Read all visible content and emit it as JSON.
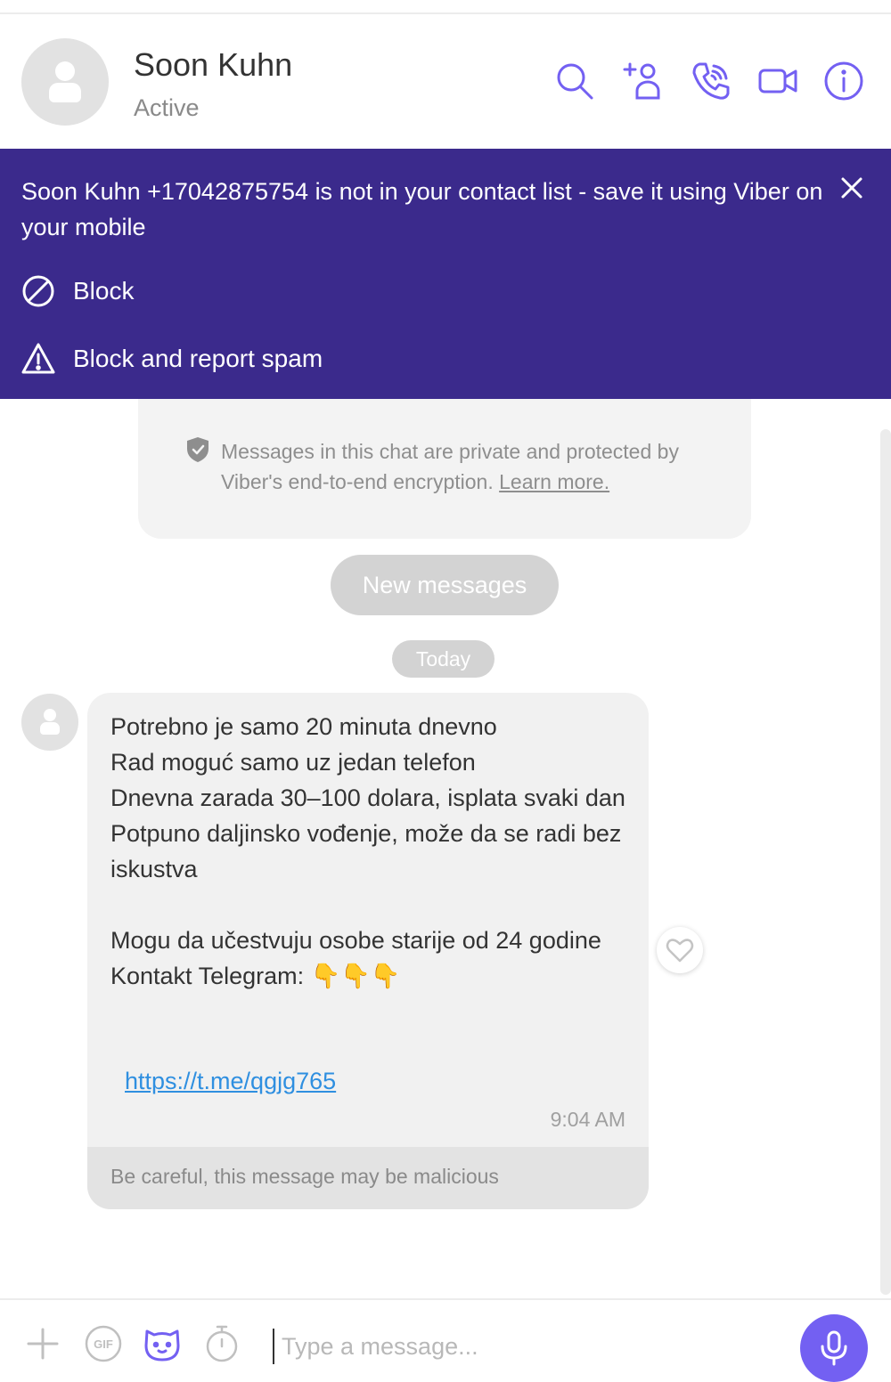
{
  "colors": {
    "accent": "#7360f2",
    "banner_bg": "#3b2a8c",
    "link": "#2f8fe0"
  },
  "header": {
    "name": "Soon Kuhn",
    "status": "Active",
    "icons": [
      "search-icon",
      "add-participant-icon",
      "audio-call-icon",
      "video-call-icon",
      "info-icon"
    ]
  },
  "banner": {
    "text": "Soon Kuhn +17042875754 is not in your contact list - save it using Viber on your mobile",
    "block_label": "Block",
    "report_label": "Block and report spam"
  },
  "encryption": {
    "text": "Messages in this chat are private and protected by Viber's end-to-end encryption.",
    "link": "Learn more."
  },
  "new_messages_label": "New messages",
  "date_separator": "Today",
  "message": {
    "lines": [
      "Potrebno je samo 20 minuta dnevno",
      "Rad moguć samo uz jedan telefon",
      "Dnevna zarada 30–100 dolara, isplata svaki dan",
      "Potpuno daljinsko vođenje, može da se radi bez iskustva",
      " ",
      "Mogu da učestvuju osobe starije od 24 godine",
      "Kontakt Telegram: 👇👇👇"
    ],
    "link": "https://t.me/qgjg765",
    "time": "9:04 AM",
    "warning": "Be careful, this message may be malicious"
  },
  "composer": {
    "placeholder": "Type a message..."
  }
}
